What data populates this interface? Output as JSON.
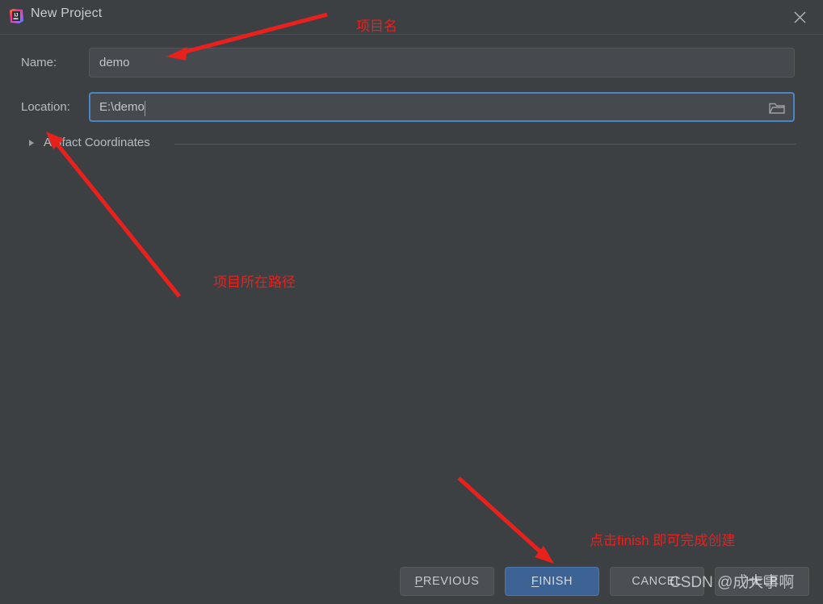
{
  "window": {
    "title": "New Project",
    "app_icon": "intellij-idea-icon",
    "close_icon": "close-icon"
  },
  "form": {
    "name": {
      "label": "Name:",
      "value": "demo"
    },
    "location": {
      "label": "Location:",
      "value": "E:\\demo",
      "browse_icon": "folder-icon",
      "focused": true
    },
    "artifact_section": {
      "label": "Artifact Coordinates",
      "expanded": false,
      "arrow_icon": "chevron-right-icon"
    }
  },
  "footer": {
    "buttons": [
      {
        "label": "PREVIOUS",
        "mnemonic": "P",
        "primary": false
      },
      {
        "label": "FINISH",
        "mnemonic": "F",
        "primary": true
      },
      {
        "label": "CANCEL",
        "mnemonic": "",
        "primary": false
      },
      {
        "label": "HELP",
        "mnemonic": "",
        "primary": false
      }
    ]
  },
  "annotations": [
    {
      "text": "项目名",
      "color": "#e8211d"
    },
    {
      "text": "项目所在路径",
      "color": "#e8211d"
    },
    {
      "text": "点击finish 即可完成创建",
      "color": "#e8211d"
    }
  ],
  "watermark": {
    "text": "CSDN @成大事啊"
  },
  "colors": {
    "background": "#3c4043",
    "field_background": "#46494d",
    "focus_border": "#4b86c4",
    "primary_button": "#3c6394",
    "annotation_red": "#e8211d",
    "text": "#c3c6c9"
  }
}
